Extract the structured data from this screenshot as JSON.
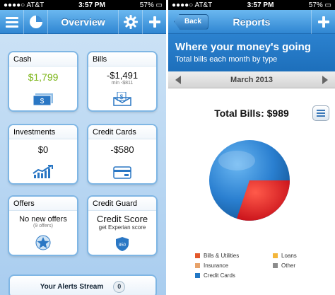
{
  "left": {
    "status": {
      "carrier": "AT&T",
      "time": "3:57 PM",
      "battery": "57%"
    },
    "nav": {
      "title": "Overview"
    },
    "cards": {
      "cash": {
        "title": "Cash",
        "value": "$1,799"
      },
      "bills": {
        "title": "Bills",
        "value": "-$1,491",
        "sub": "min -$811"
      },
      "investments": {
        "title": "Investments",
        "value": "$0"
      },
      "credit_cards": {
        "title": "Credit Cards",
        "value": "-$580"
      },
      "offers": {
        "title": "Offers",
        "value": "No new offers",
        "sub": "(9 offers)"
      },
      "credit_guard": {
        "title": "Credit Guard",
        "value": "Credit Score",
        "sub": "get Experian score",
        "badge": "850"
      }
    },
    "alerts": {
      "label": "Your Alerts Stream",
      "count": "0"
    }
  },
  "right": {
    "status": {
      "carrier": "AT&T",
      "time": "3:57 PM",
      "battery": "57%"
    },
    "nav": {
      "back": "Back",
      "title": "Reports"
    },
    "banner": {
      "heading": "Where your money's going",
      "subheading": "Total bills each month by type"
    },
    "month": "March 2013",
    "total": "Total Bills: $989",
    "legend": [
      {
        "label": "Bills & Utilities",
        "color": "#e2582b"
      },
      {
        "label": "Loans",
        "color": "#f3b63b"
      },
      {
        "label": "Insurance",
        "color": "#e7a26a"
      },
      {
        "label": "Other",
        "color": "#8c8c8c"
      },
      {
        "label": "Credit Cards",
        "color": "#2277c4"
      }
    ]
  },
  "colors": {
    "accent": "#2f86d2",
    "cash_green": "#7cb518",
    "pie_blue": "#2a7fd0",
    "pie_red": "#e21e1e"
  }
}
